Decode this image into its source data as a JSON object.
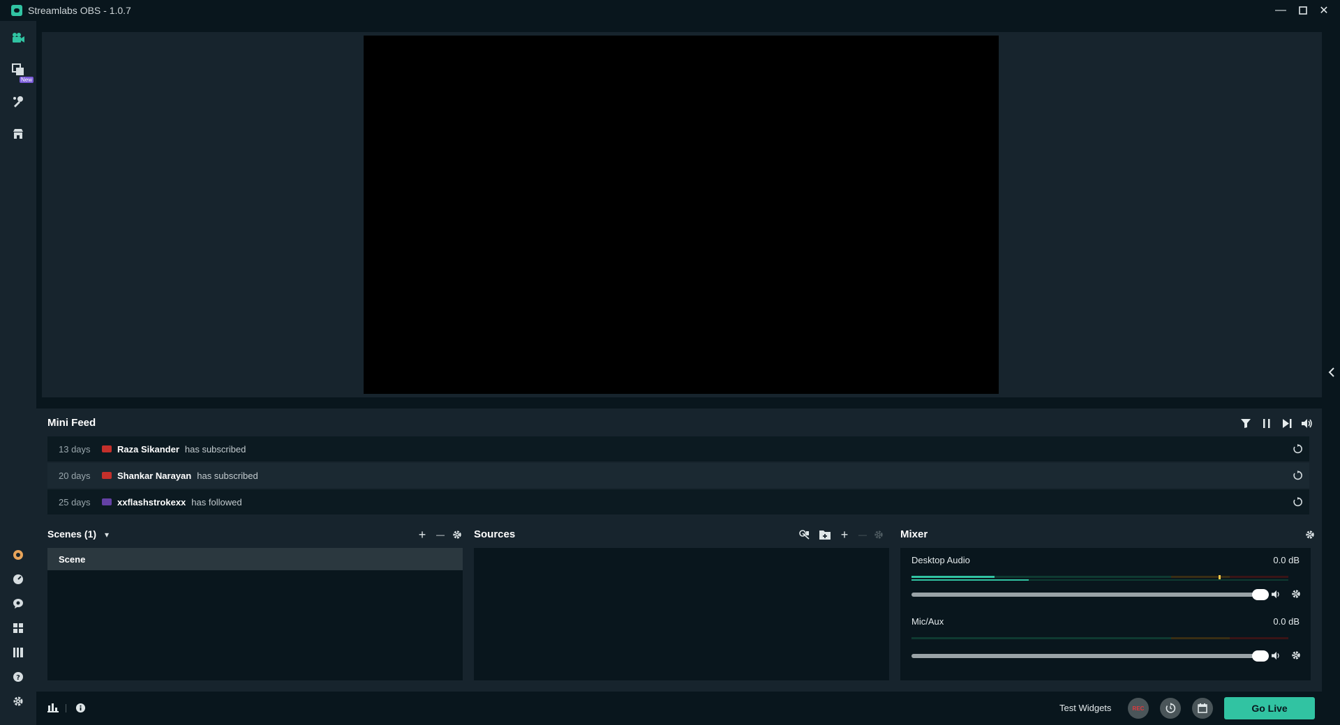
{
  "window": {
    "title": "Streamlabs OBS - 1.0.7",
    "minimize_glyph": "—",
    "maximize_glyph": "☐",
    "close_glyph": "✕"
  },
  "nav": {
    "top_items": [
      {
        "icon": "studio-camera-icon"
      },
      {
        "icon": "layout-editor-icon",
        "badge": "New"
      },
      {
        "icon": "themes-icon"
      },
      {
        "icon": "app-store-icon"
      }
    ],
    "bottom_items": [
      {
        "icon": "prime-icon"
      },
      {
        "icon": "dashboard-icon"
      },
      {
        "icon": "chat-icon"
      },
      {
        "icon": "layouts-icon"
      },
      {
        "icon": "studio-mode-icon"
      },
      {
        "icon": "help-icon"
      },
      {
        "icon": "settings-icon"
      }
    ],
    "collapse_glyph": "‹"
  },
  "minifeed": {
    "title": "Mini Feed",
    "controls": [
      "filter-icon",
      "pause-icon",
      "skip-icon",
      "volume-icon"
    ],
    "items": [
      {
        "time": "13 days",
        "platform": "youtube",
        "platform_color": "#c4302b",
        "user": "Raza Sikander",
        "action": "has subscribed"
      },
      {
        "time": "20 days",
        "platform": "youtube",
        "platform_color": "#c4302b",
        "user": "Shankar Narayan",
        "action": "has subscribed"
      },
      {
        "time": "25 days",
        "platform": "twitch",
        "platform_color": "#6441a5",
        "user": "xxflashstrokexx",
        "action": "has followed"
      }
    ]
  },
  "scenes": {
    "title": "Scenes (1)",
    "dropdown_glyph": "▾",
    "add_glyph": "+",
    "remove_glyph": "—",
    "items": [
      "Scene"
    ]
  },
  "sources": {
    "title": "Sources",
    "add_glyph": "+",
    "remove_glyph": "—"
  },
  "mixer": {
    "title": "Mixer",
    "channels": [
      {
        "name": "Desktop Audio",
        "db": "0.0 dB",
        "level": 0.22,
        "volume": 1.0
      },
      {
        "name": "Mic/Aux",
        "db": "0.0 dB",
        "level": 0.0,
        "volume": 1.0
      }
    ]
  },
  "footer": {
    "test_widgets_label": "Test Widgets",
    "rec_label": "REC",
    "go_live_label": "Go Live"
  },
  "colors": {
    "accent": "#31c3a2",
    "background": "#09161d",
    "panel": "#17242d",
    "rec_red": "#e0393e"
  }
}
